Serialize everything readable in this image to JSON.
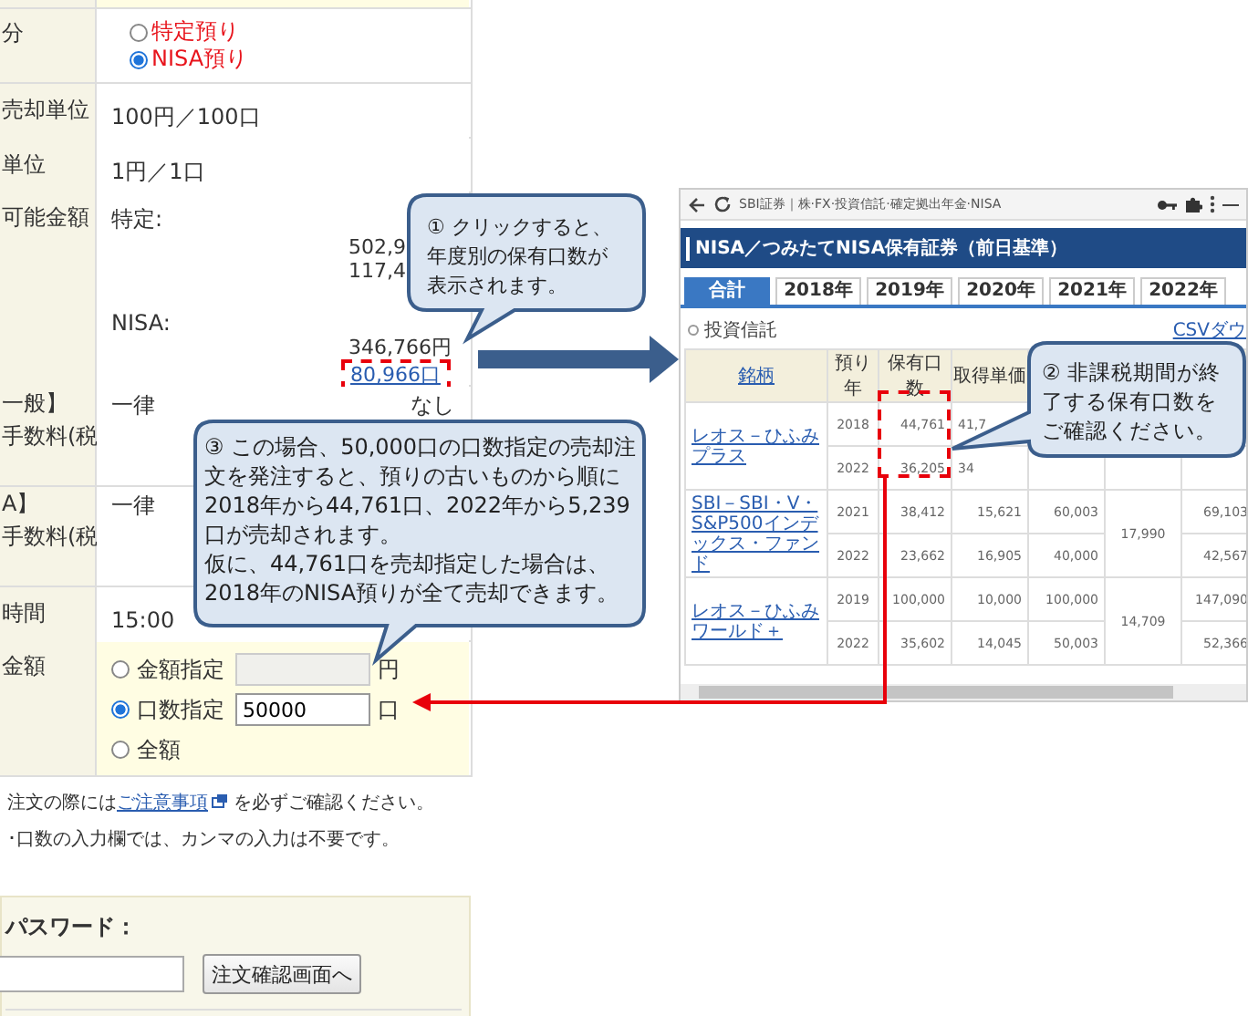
{
  "form": {
    "rows": [
      {
        "kind": "blank",
        "highlight": true
      },
      {
        "kind": "radio",
        "label": "分",
        "highlight": false,
        "options": [
          {
            "label": "特定預り",
            "selected": false
          },
          {
            "label": "NISA預り",
            "selected": true
          }
        ]
      },
      {
        "kind": "text",
        "label": "売却単位",
        "value": "100円／100口"
      },
      {
        "kind": "text",
        "label": "単位",
        "value": "1円／1口"
      },
      {
        "kind": "balance",
        "label": "可能金額",
        "sections": [
          {
            "name": "特定:",
            "amounts": [
              "502,9",
              "117,4"
            ]
          },
          {
            "name": "NISA:",
            "amounts": [
              "346,766円"
            ],
            "link": "80,966口"
          }
        ]
      },
      {
        "kind": "fee",
        "label_lines": [
          "一般】",
          "手数料(税"
        ],
        "value": "一律",
        "note": "なし"
      },
      {
        "kind": "fee",
        "label_lines": [
          "A】",
          "手数料(税"
        ],
        "value": "一律"
      },
      {
        "kind": "text",
        "label": "時間",
        "value": "15:00"
      },
      {
        "kind": "amount",
        "label": "金額",
        "highlight": true,
        "options": [
          {
            "label": "金額指定",
            "selected": false,
            "input": {
              "disabled": true
            },
            "unit": "円"
          },
          {
            "label": "口数指定",
            "selected": true,
            "input": {
              "value": "50000",
              "disabled": false
            },
            "unit": "口"
          },
          {
            "label": "全額",
            "selected": false
          }
        ]
      }
    ]
  },
  "notes": [
    {
      "before": "注文の際には",
      "link": "ご注意事項",
      "after": "を必ずご確認ください。"
    },
    {
      "before": "･口数の入力欄では、カンマの入力は不要です。"
    }
  ],
  "password": {
    "label": "パスワード：",
    "button": "注文確認画面へ"
  },
  "inset": {
    "address": "SBI証券｜株·FX·投資信託·確定拠出年金·NISA",
    "title": "NISA／つみたてNISA保有証券（前日基準）",
    "tabs": [
      {
        "label": "合計",
        "selected": true
      },
      {
        "label": "2018年",
        "selected": false
      },
      {
        "label": "2019年",
        "selected": false
      },
      {
        "label": "2020年",
        "selected": false
      },
      {
        "label": "2021年",
        "selected": false
      },
      {
        "label": "2022年",
        "selected": false
      }
    ],
    "section": "投資信託",
    "csv_link": "CSVダウ",
    "columns": [
      "銘柄",
      "預り年",
      "保有口数",
      "取得単価"
    ],
    "funds": [
      {
        "name": "レオス－ひふみプラス",
        "rows": [
          {
            "year": "2018",
            "units": "44,761",
            "cost": "41,7"
          },
          {
            "year": "2022",
            "units": "36,205",
            "cost": "34"
          }
        ]
      },
      {
        "name": "SBI－SBI・V・S&P500インデックス・ファンド",
        "price": "17,990",
        "rows": [
          {
            "year": "2021",
            "units": "38,412",
            "cost": "15,621",
            "amount": "60,003",
            "value": "69,103"
          },
          {
            "year": "2022",
            "units": "23,662",
            "cost": "16,905",
            "amount": "40,000",
            "value": "42,567"
          }
        ]
      },
      {
        "name": "レオス－ひふみワールド＋",
        "price": "14,709",
        "rows": [
          {
            "year": "2019",
            "units": "100,000",
            "cost": "10,000",
            "amount": "100,000",
            "value": "147,090"
          },
          {
            "year": "2022",
            "units": "35,602",
            "cost": "14,045",
            "amount": "50,003",
            "value": "52,366"
          }
        ]
      }
    ]
  },
  "callouts": [
    {
      "paragraphs": [
        "① クリックすると、年度別の保有口数が表示されます。"
      ]
    },
    {
      "paragraphs": [
        "② 非課税期間が終了する保有口数をご確認ください。"
      ]
    },
    {
      "paragraphs": [
        "③ この場合、50,000口の口数指定の売却注文を発注すると、預りの古いものから順に2018年から44,761口、2022年から5,239口が売却されます。",
        "仮に、44,761口を売却指定した場合は、2018年のNISA預りが全て売却できます。"
      ]
    }
  ]
}
